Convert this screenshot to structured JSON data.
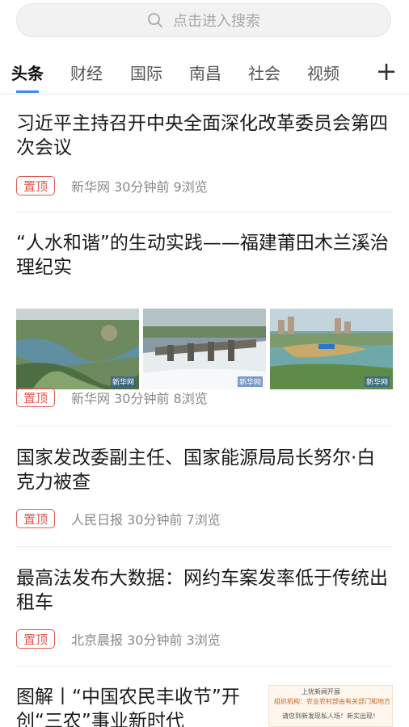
{
  "search": {
    "placeholder": "点击进入搜索",
    "icon": "search-icon"
  },
  "tabs": [
    {
      "label": "头条",
      "active": true
    },
    {
      "label": "财经"
    },
    {
      "label": "国际"
    },
    {
      "label": "南昌"
    },
    {
      "label": "社会"
    },
    {
      "label": "视频"
    }
  ],
  "tab_more": "+",
  "accent_color": "#3a8ee6",
  "badge_color": "#e05a4f",
  "articles": [
    {
      "title": "习近平主持召开中央全面深化改革委员会第四次会议",
      "badge": "置顶",
      "meta": "新华网  30分钟前  9浏览"
    },
    {
      "title": "“人水和谐”的生动实践——福建莆田木兰溪治理纪实",
      "badge": "置顶",
      "meta": "新华网  30分钟前  8浏览",
      "images": [
        {
          "watermark": "新华网"
        },
        {
          "watermark": "新华网"
        },
        {
          "watermark": "新华网"
        }
      ]
    },
    {
      "title": "国家发改委副主任、国家能源局局长努尔·白克力被查",
      "badge": "置顶",
      "meta": "人民日报  30分钟前  7浏览"
    },
    {
      "title": "最高法发布大数据：网约车案发率低于传统出租车",
      "badge": "置顶",
      "meta": "北京晨报  30分钟前  3浏览"
    },
    {
      "title": "图解丨“中国农民丰收节”开创“三农”事业新时代",
      "thumb_text": {
        "line1": "上犹新闻开展",
        "line2": "组织机构：农业农村部由有关部门和地方",
        "line3": "请您到新发现私人场！新实出现！"
      }
    }
  ]
}
